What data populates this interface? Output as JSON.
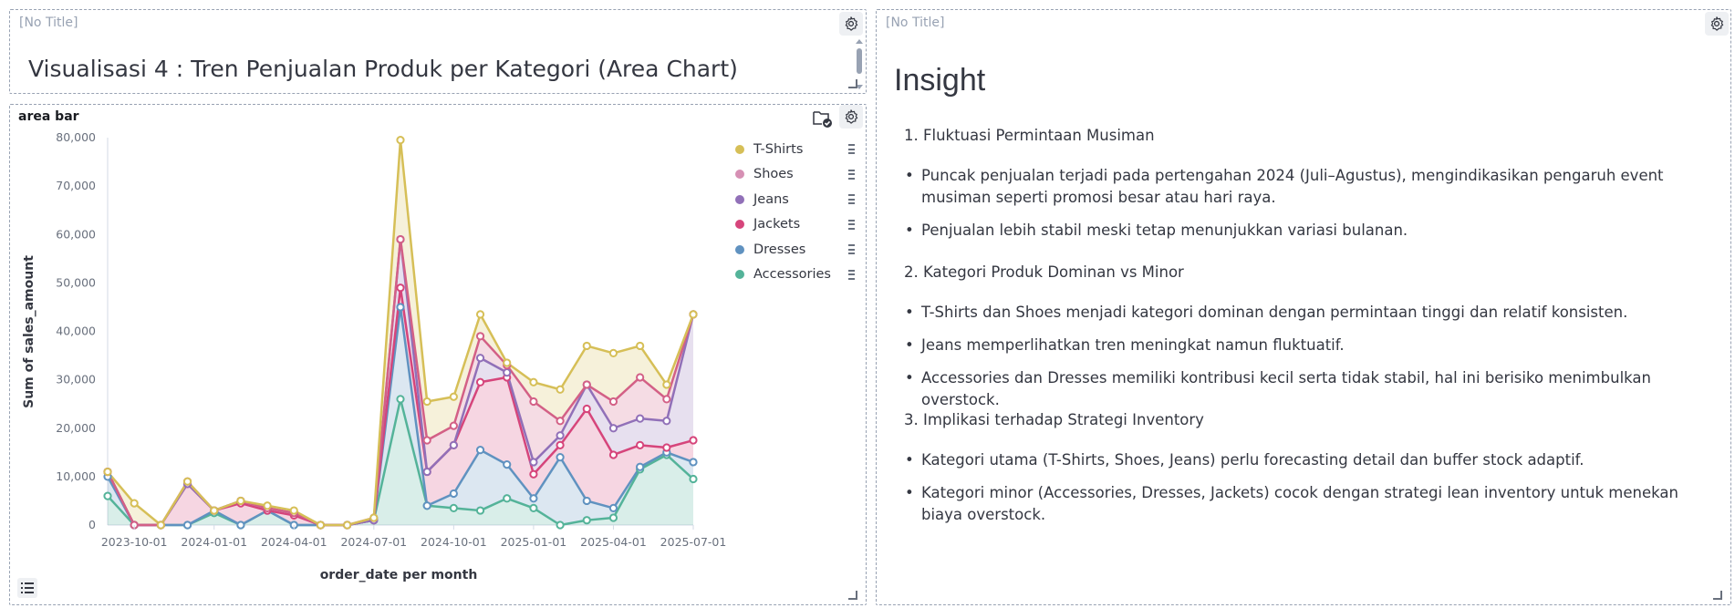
{
  "header_panel": {
    "untitled_label": "[No Title]",
    "title": "Visualisasi 4 : Tren Penjualan Produk per Kategori (Area Chart)"
  },
  "chart_panel": {
    "title": "area bar"
  },
  "insight_panel": {
    "untitled_label": "[No Title]",
    "heading": "Insight",
    "sections": [
      {
        "title": "1. Fluktuasi Permintaan Musiman",
        "bullets": [
          "Puncak penjualan terjadi pada pertengahan 2024 (Juli–Agustus), mengindikasikan pengaruh event musiman seperti promosi besar atau hari raya.",
          "Penjualan lebih stabil meski tetap menunjukkan variasi bulanan."
        ]
      },
      {
        "title": "2. Kategori Produk Dominan vs Minor",
        "bullets": [
          "T-Shirts dan Shoes menjadi kategori dominan dengan permintaan tinggi dan relatif konsisten.",
          "Jeans memperlihatkan tren meningkat namun fluktuatif.",
          "Accessories dan Dresses memiliki kontribusi kecil serta tidak stabil, hal ini berisiko menimbulkan overstock."
        ]
      },
      {
        "title": "3. Implikasi terhadap Strategi Inventory",
        "bullets": [
          "Kategori utama (T-Shirts, Shoes, Jeans) perlu forecasting detail dan buffer stock adaptif.",
          "Kategori minor (Accessories, Dresses, Jackets) cocok dengan strategi lean inventory untuk menekan biaya overstock."
        ]
      }
    ]
  },
  "colors": {
    "T-Shirts": "#d6bf57",
    "Shoes": "#d36086",
    "Jeans": "#9170b8",
    "Jackets": "#d6457b",
    "Dresses": "#6092c0",
    "Accessories": "#54b399",
    "Shoes_legend": "#d690b4"
  },
  "icons": [
    "gear-icon",
    "save-check-icon",
    "legend-toggle-icon",
    "legend-item-menu-icon"
  ],
  "chart_data": {
    "type": "area",
    "stacked": true,
    "xlabel": "order_date per month",
    "ylabel": "Sum of sales_amount",
    "ylim": [
      0,
      80000
    ],
    "y_ticks": [
      0,
      10000,
      20000,
      30000,
      40000,
      50000,
      60000,
      70000,
      80000
    ],
    "y_tick_labels": [
      "0",
      "10,000",
      "20,000",
      "30,000",
      "40,000",
      "50,000",
      "60,000",
      "70,000",
      "80,000"
    ],
    "x_tick_labels": [
      "2023-10-01",
      "2024-01-01",
      "2024-04-01",
      "2024-07-01",
      "2024-10-01",
      "2025-01-01",
      "2025-04-01",
      "2025-07-01"
    ],
    "x": [
      "2023-09",
      "2023-10",
      "2023-11",
      "2023-12",
      "2024-01",
      "2024-02",
      "2024-03",
      "2024-04",
      "2024-05",
      "2024-06",
      "2024-07",
      "2024-08",
      "2024-09",
      "2024-10",
      "2024-11",
      "2024-12",
      "2025-01",
      "2025-02",
      "2025-03",
      "2025-04",
      "2025-05",
      "2025-06",
      "2025-07"
    ],
    "legend_position": "top-right",
    "series_cumulative": [
      {
        "name": "Accessories",
        "values": [
          6000,
          0,
          0,
          0,
          2500,
          0,
          3000,
          0,
          0,
          0,
          1000,
          26000,
          4000,
          3500,
          3000,
          5500,
          3500,
          0,
          1000,
          1500,
          11500,
          14500,
          9500
        ]
      },
      {
        "name": "Dresses",
        "values": [
          10000,
          0,
          0,
          0,
          3000,
          0,
          3000,
          0,
          0,
          0,
          1000,
          45000,
          4000,
          6500,
          15500,
          12500,
          5500,
          14000,
          5000,
          3500,
          12000,
          15000,
          13000
        ]
      },
      {
        "name": "Jackets",
        "values": [
          11000,
          0,
          0,
          8500,
          3000,
          4500,
          3000,
          2000,
          0,
          0,
          1000,
          49000,
          11000,
          16500,
          29500,
          30500,
          10500,
          16500,
          24000,
          14500,
          16500,
          16000,
          17500
        ]
      },
      {
        "name": "Jeans",
        "values": [
          11000,
          0,
          0,
          8500,
          3000,
          5000,
          3500,
          2500,
          0,
          0,
          1000,
          59000,
          11000,
          16500,
          34500,
          31500,
          13000,
          18500,
          29000,
          20000,
          22000,
          21500,
          43500
        ]
      },
      {
        "name": "Shoes",
        "values": [
          11000,
          0,
          0,
          9000,
          3000,
          5000,
          3500,
          2500,
          0,
          0,
          1500,
          59000,
          17500,
          20500,
          39000,
          33000,
          25500,
          21500,
          29000,
          25500,
          30500,
          26000,
          43500
        ]
      },
      {
        "name": "T-Shirts",
        "values": [
          11000,
          4500,
          0,
          9000,
          3000,
          5000,
          4000,
          3000,
          0,
          0,
          1500,
          79500,
          25500,
          26500,
          43500,
          33500,
          29500,
          28000,
          37000,
          35500,
          37000,
          29000,
          43500
        ]
      }
    ]
  }
}
